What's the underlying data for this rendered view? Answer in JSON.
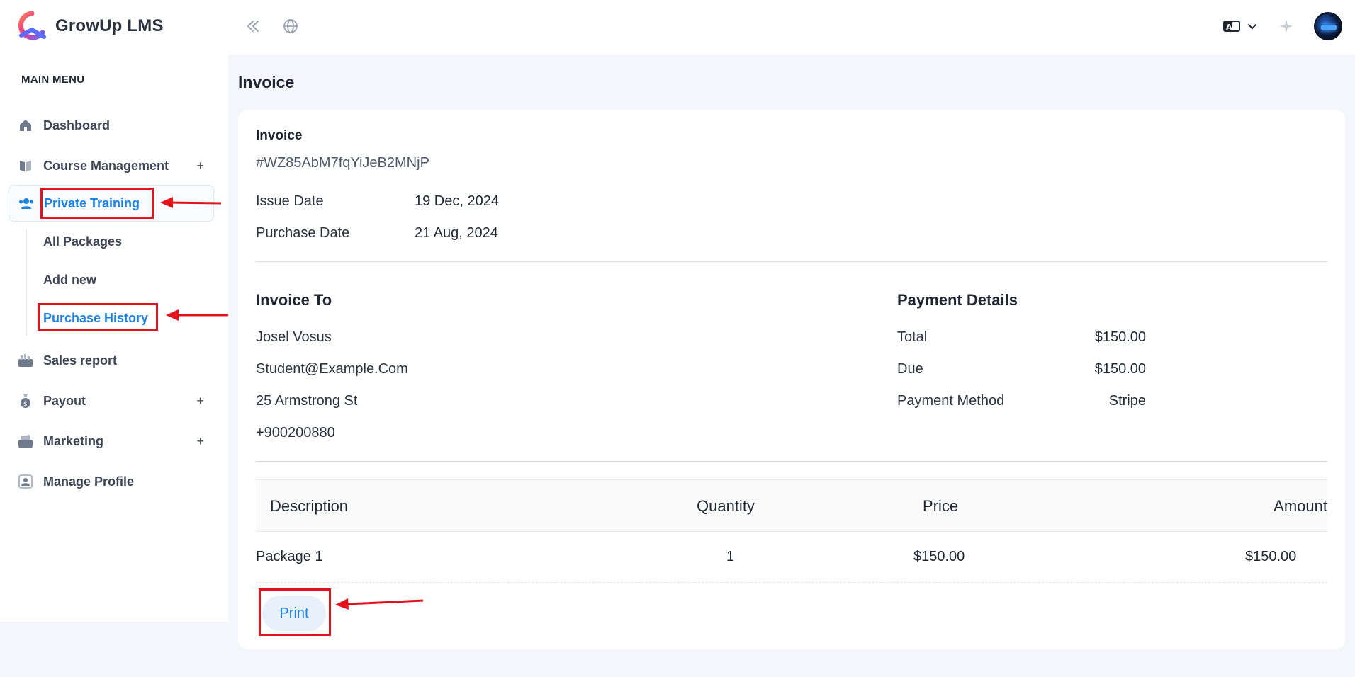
{
  "app": {
    "name": "GrowUp LMS"
  },
  "sidebar": {
    "menu_title": "MAIN MENU",
    "items": [
      {
        "label": "Dashboard",
        "icon": "home-icon",
        "expandable": false
      },
      {
        "label": "Course Management",
        "icon": "book-icon",
        "expandable": true,
        "toggle": "+"
      },
      {
        "label": "Private Training",
        "icon": "users-icon",
        "expandable": true,
        "toggle": "−",
        "active": true
      },
      {
        "label": "Sales report",
        "icon": "chart-icon",
        "expandable": false
      },
      {
        "label": "Payout",
        "icon": "moneybag-icon",
        "expandable": true,
        "toggle": "+"
      },
      {
        "label": "Marketing",
        "icon": "megaphone-icon",
        "expandable": true,
        "toggle": "+"
      },
      {
        "label": "Manage Profile",
        "icon": "profile-icon",
        "expandable": false
      }
    ],
    "sub_items": [
      {
        "label": "All Packages"
      },
      {
        "label": "Add new"
      },
      {
        "label": "Purchase History",
        "active": true
      }
    ]
  },
  "page": {
    "title": "Invoice"
  },
  "invoice": {
    "label": "Invoice",
    "id": "#WZ85AbM7fqYiJeB2MNjP",
    "issue_date_label": "Issue Date",
    "issue_date": "19 Dec, 2024",
    "purchase_date_label": "Purchase Date",
    "purchase_date": "21 Aug, 2024"
  },
  "invoice_to": {
    "title": "Invoice To",
    "name": "Josel Vosus",
    "email": "Student@Example.Com",
    "address": "25 Armstrong St",
    "phone": "+900200880"
  },
  "payment": {
    "title": "Payment Details",
    "total_label": "Total",
    "total": "$150.00",
    "due_label": "Due",
    "due": "$150.00",
    "method_label": "Payment Method",
    "method": "Stripe"
  },
  "table": {
    "headers": [
      "Description",
      "Quantity",
      "Price",
      "Amount"
    ],
    "rows": [
      {
        "description": "Package 1",
        "quantity": "1",
        "price": "$150.00",
        "amount": "$150.00"
      }
    ]
  },
  "actions": {
    "print_label": "Print"
  },
  "colors": {
    "accent": "#1b82e8",
    "annotation": "#e3121b"
  }
}
